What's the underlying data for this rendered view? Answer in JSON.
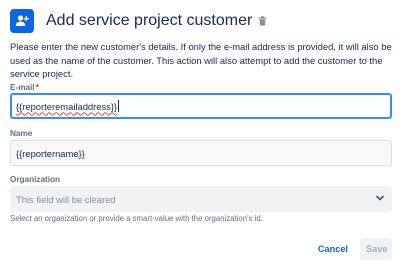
{
  "dialog": {
    "title": "Add service project customer",
    "description": "Please enter the new customer's details. If only the e-mail address is provided, it will also be used as the name of the customer. This action will also attempt to add the customer to the service project.",
    "header_icon": "add-user-icon",
    "title_action_icon": "trash-icon"
  },
  "fields": {
    "email": {
      "label": "E-mail",
      "required_marker": "*",
      "value": "{{reporteremailaddress}}"
    },
    "name": {
      "label": "Name",
      "value": "{{reportername}}"
    },
    "organization": {
      "label": "Organization",
      "placeholder": "This field will be cleared",
      "helper": "Select an organization or provide a smart-value with the organization's id.",
      "dropdown_icon": "chevron-down-icon"
    }
  },
  "footer": {
    "cancel_label": "Cancel",
    "save_label": "Save"
  },
  "colors": {
    "accent": "#0c66e4",
    "focus_border": "#388bff",
    "required": "#c9372c",
    "disabled_text": "#a5adba"
  }
}
